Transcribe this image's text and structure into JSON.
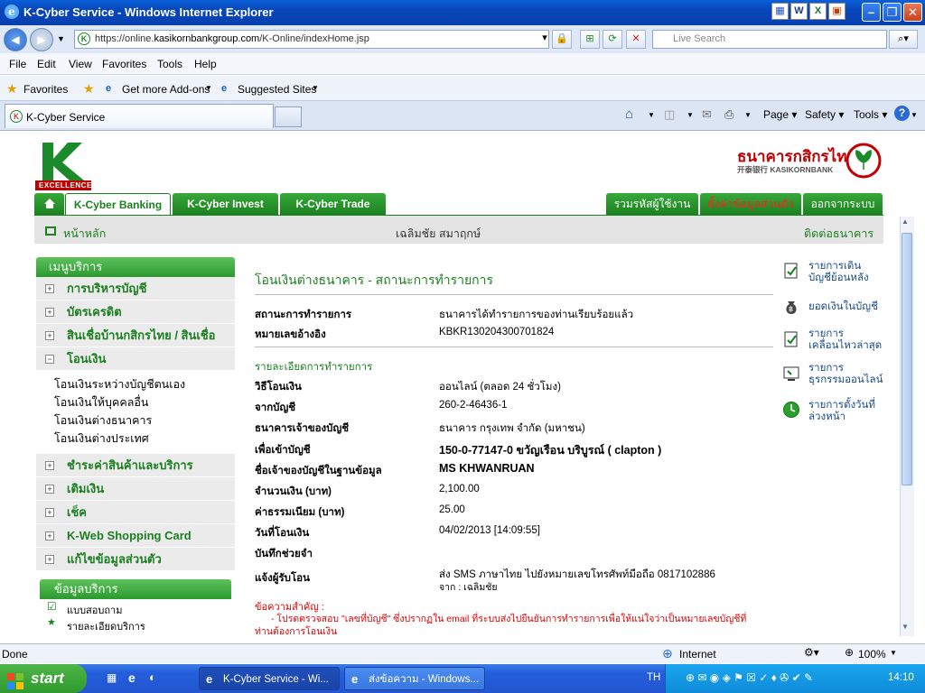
{
  "window": {
    "title": "K-Cyber Service - Windows Internet Explorer"
  },
  "browser": {
    "url_prefix": "https://online.",
    "url_domain": "kasikornbankgroup.com",
    "url_path": "/K-Online/indexHome.jsp",
    "search_placeholder": "Live Search",
    "menu": [
      "File",
      "Edit",
      "View",
      "Favorites",
      "Tools",
      "Help"
    ],
    "favorites_label": "Favorites",
    "fav_items": [
      "Get more Add-ons",
      "Suggested Sites"
    ],
    "tab_title": "K-Cyber Service",
    "cmd": {
      "page": "Page",
      "safety": "Safety",
      "tools": "Tools"
    },
    "status": {
      "left": "Done",
      "zone": "Internet",
      "zoom": "100%"
    }
  },
  "site": {
    "logo_text": "EXCELLENCE",
    "bank_thai": "ธนาคารกสิกรไทย",
    "bank_en": "开泰银行 KASIKORNBANK",
    "main_tabs": [
      "K-Cyber Banking",
      "K-Cyber Invest",
      "K-Cyber Trade"
    ],
    "right_tabs": [
      "รวมรหัสผู้ใช้งาน",
      "ตั้งค่าข้อมูลส่วนตัว",
      "ออกจากระบบ"
    ],
    "home_label": "หน้าหลัก",
    "user_name": "เฉลิมชัย สมาฤกษ์",
    "contact": "ติดต่อธนาคาร"
  },
  "sidebar": {
    "head": "เมนูบริการ",
    "items": [
      {
        "label": "การบริหารบัญชี",
        "sign": "+"
      },
      {
        "label": "บัตรเครดิต",
        "sign": "+"
      },
      {
        "label": "สินเชื่อบ้านกสิกรไทย / สินเชื่ออื่นๆ",
        "sign": "+"
      },
      {
        "label": "โอนเงิน",
        "sign": "−"
      }
    ],
    "subitems": [
      "โอนเงินระหว่างบัญชีตนเอง",
      "โอนเงินให้บุคคลอื่น",
      "โอนเงินต่างธนาคาร",
      "โอนเงินต่างประเทศ"
    ],
    "items2": [
      {
        "label": "ชำระค่าสินค้าและบริการ",
        "sign": "+"
      },
      {
        "label": "เติมเงิน",
        "sign": "+"
      },
      {
        "label": "เช็ค",
        "sign": "+"
      },
      {
        "label": "K-Web Shopping Card",
        "sign": "+"
      },
      {
        "label": "แก้ไขข้อมูลส่วนตัว",
        "sign": "+"
      }
    ],
    "info_head": "ข้อมูลบริการ",
    "info_items": [
      "แบบสอบถาม",
      "รายละเอียดบริการ"
    ]
  },
  "main": {
    "title": "โอนเงินต่างธนาคาร - สถานะการทำรายการ",
    "rows_top": [
      {
        "label": "สถานะการทำรายการ",
        "value": "ธนาคารได้ทำรายการของท่านเรียบร้อยแล้ว"
      },
      {
        "label": "หมายเลขอ้างอิง",
        "value": "KBKR130204300701824"
      }
    ],
    "section": "รายละเอียดการทำรายการ",
    "rows": [
      {
        "label": "วิธีโอนเงิน",
        "value": "ออนไลน์ (ตลอด 24 ชั่วโมง)"
      },
      {
        "label": "จากบัญชี",
        "value": "260-2-46436-1"
      },
      {
        "label": "ธนาคารเจ้าของบัญชี",
        "value": "ธนาคาร กรุงเทพ จำกัด (มหาชน)"
      },
      {
        "label": "เพื่อเข้าบัญชี",
        "value": "150-0-77147-0 ขวัญเรือน บริบูรณ์ ( clapton )"
      },
      {
        "label": "ชื่อเจ้าของบัญชีในฐานข้อมูล",
        "value": "MS KHWANRUAN"
      },
      {
        "label": "จำนวนเงิน (บาท)",
        "value": "2,100.00"
      },
      {
        "label": "ค่าธรรมเนียม (บาท)",
        "value": "25.00"
      },
      {
        "label": "วันที่โอนเงิน",
        "value": "04/02/2013 [14:09:55]"
      },
      {
        "label": "บันทึกช่วยจำ",
        "value": ""
      },
      {
        "label": "แจ้งผู้รับโอน",
        "value": "ส่ง SMS ภาษาไทย ไปยังหมายเลขโทรศัพท์มือถือ 0817102886"
      }
    ],
    "notify_line2": "จาก : เฉลิมชัย",
    "notice_head": "ข้อความสำคัญ :",
    "notice_1": "- โปรดตรวจสอบ \"เลขที่บัญชี\" ซึ่งปรากฏใน email ที่ระบบส่งไปยืนยันการทำรายการเพื่อให้แน่ใจว่าเป็นหมายเลขบัญชีที่",
    "notice_2": "ท่านต้องการโอนเงิน"
  },
  "right_menu": [
    [
      "รายการเดิน",
      "บัญชีย้อนหลัง"
    ],
    [
      "ยอดเงินในบัญชี"
    ],
    [
      "รายการ",
      "เคลื่อนไหวล่าสุด"
    ],
    [
      "รายการ",
      "ธุรกรรมออนไลน์"
    ],
    [
      "รายการตั้งวันที่",
      "ล่วงหน้า"
    ]
  ],
  "taskbar": {
    "start": "start",
    "task1": "K-Cyber Service - Wi...",
    "task2": "ส่งข้อความ - Windows...",
    "lang": "TH",
    "clock": "14:10"
  },
  "colors": {
    "bank_green": "#1b8120",
    "bank_red": "#c00000",
    "link_blue": "#1a4a8a"
  }
}
